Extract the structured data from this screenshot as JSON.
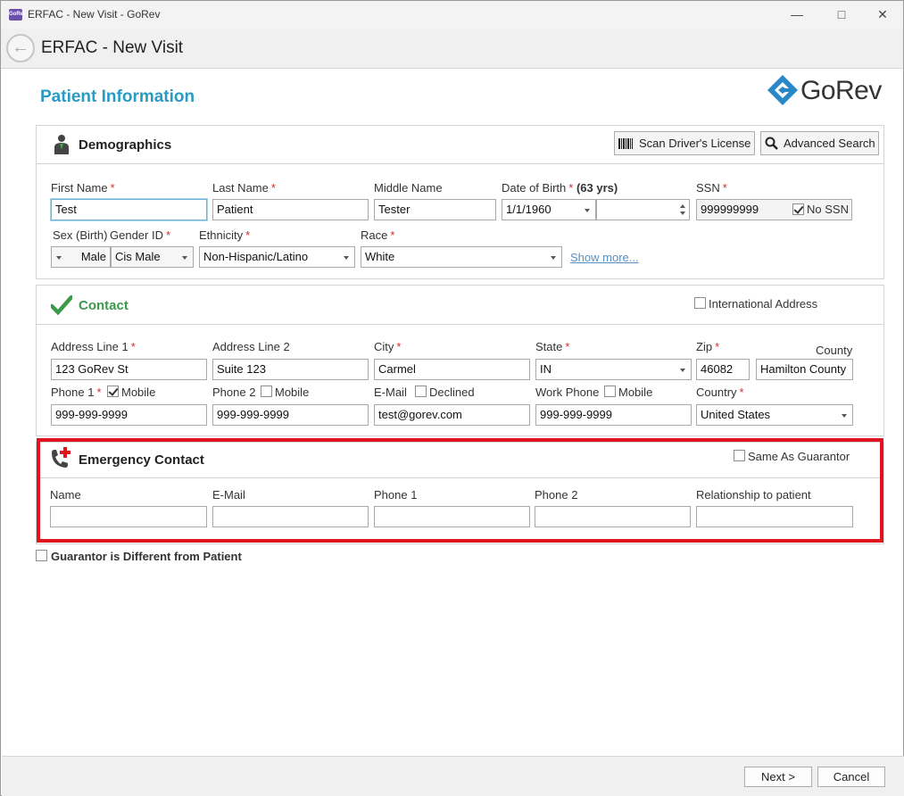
{
  "window": {
    "title": "ERFAC - New Visit - GoRev",
    "app_icon_text": "GoRev",
    "minimize": "—",
    "maximize": "□",
    "close": "✕"
  },
  "nav": {
    "title": "ERFAC - New Visit",
    "back_icon": "←"
  },
  "page": {
    "title": "Patient Information"
  },
  "logo": {
    "text": "GoRev"
  },
  "demographics": {
    "title": "Demographics",
    "scan_button": "Scan Driver's License",
    "search_button": "Advanced Search",
    "labels": {
      "first_name": "First Name",
      "last_name": "Last Name",
      "middle_name": "Middle Name",
      "dob": "Date of Birth",
      "age": "(63 yrs)",
      "ssn": "SSN",
      "sex": "Sex (Birth)",
      "gender": "Gender ID",
      "ethnicity": "Ethnicity",
      "race": "Race",
      "no_ssn": "No SSN"
    },
    "values": {
      "first_name": "Test",
      "last_name": "Patient",
      "middle_name": "Tester",
      "dob": "1/1/1960",
      "ssn": "999999999",
      "sex": "Male",
      "gender": "Cis Male",
      "ethnicity": "Non-Hispanic/Latino",
      "race": "White"
    },
    "show_more": "Show more..."
  },
  "contact": {
    "title": "Contact",
    "intl_address": "International Address",
    "labels": {
      "address1": "Address Line 1",
      "address2": "Address Line 2",
      "city": "City",
      "state": "State",
      "zip": "Zip",
      "county": "County",
      "phone1": "Phone 1",
      "mobile": "Mobile",
      "phone2": "Phone 2",
      "email": "E-Mail",
      "declined": "Declined",
      "work_phone": "Work Phone",
      "country": "Country"
    },
    "values": {
      "address1": "123 GoRev St",
      "address2": "Suite 123",
      "city": "Carmel",
      "state": "IN",
      "zip": "46082",
      "county": "Hamilton County",
      "phone1": "999-999-9999",
      "phone2": "999-999-9999",
      "email": "test@gorev.com",
      "work_phone": "999-999-9999",
      "country": "United States"
    }
  },
  "emergency": {
    "title": "Emergency Contact",
    "same_as_guarantor": "Same As Guarantor",
    "labels": {
      "name": "Name",
      "email": "E-Mail",
      "phone1": "Phone 1",
      "phone2": "Phone 2",
      "relationship": "Relationship to patient"
    }
  },
  "guarantor": {
    "label": "Guarantor is Different from Patient"
  },
  "footer": {
    "next": "Next >",
    "cancel": "Cancel"
  },
  "colors": {
    "accent": "#2a9cc4",
    "contact_green": "#3a9a4a",
    "highlight_red": "#e0141e"
  }
}
